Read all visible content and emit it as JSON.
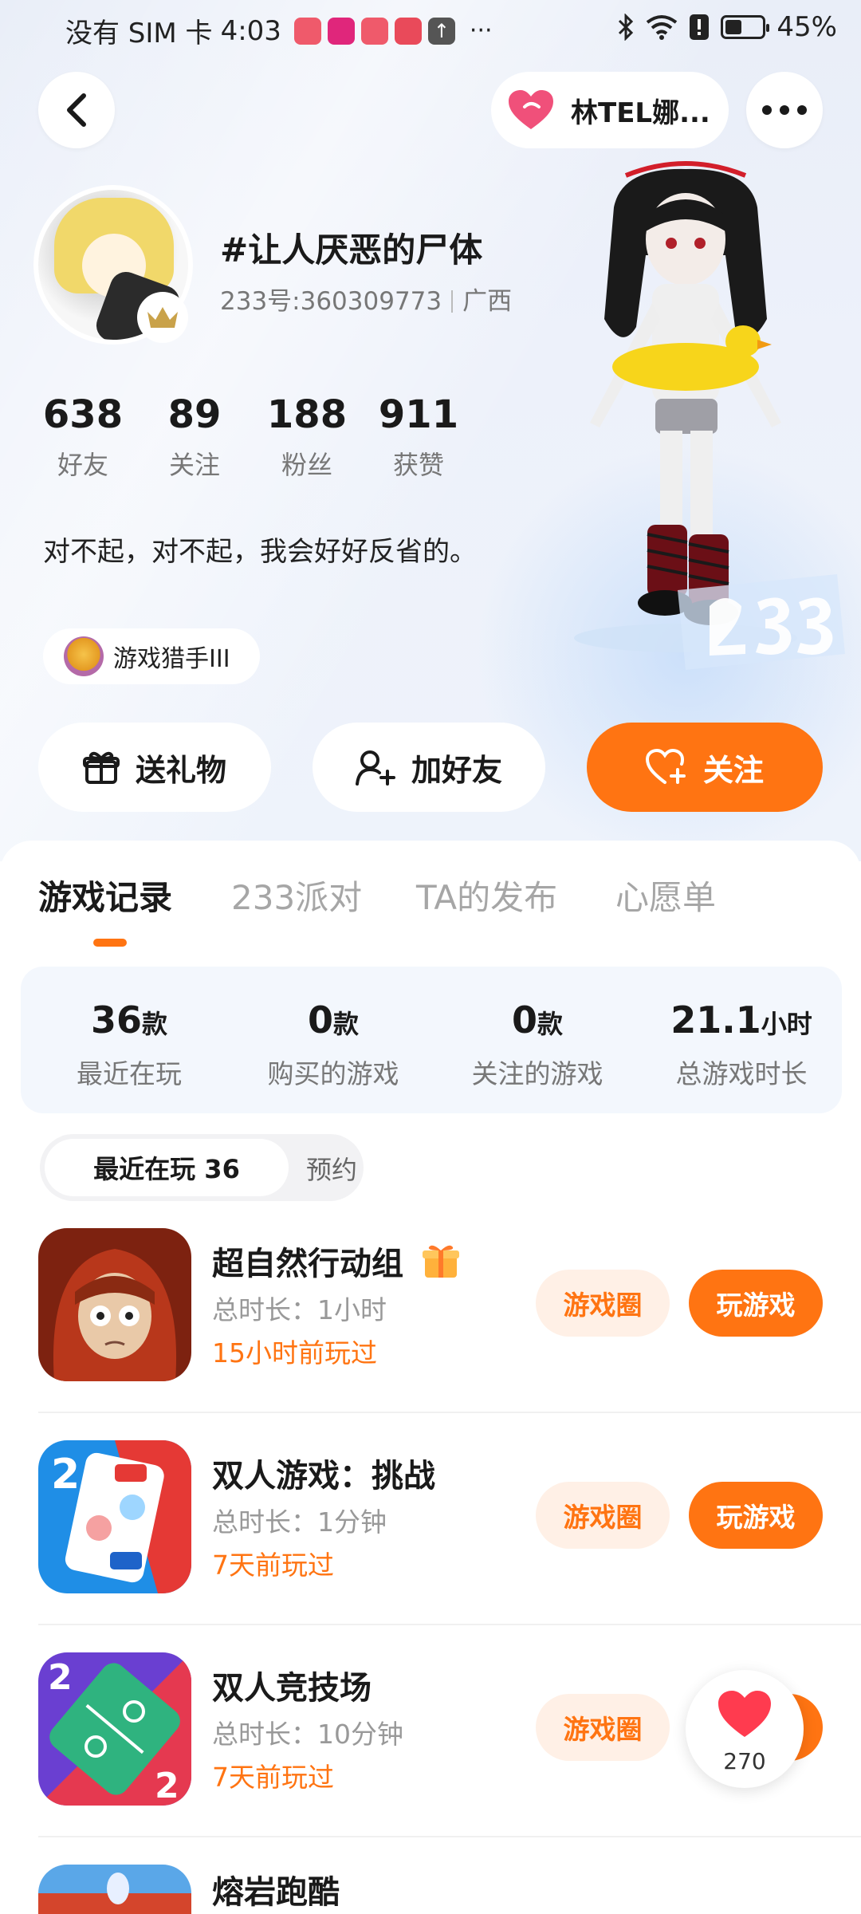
{
  "status_bar": {
    "carrier": "没有 SIM 卡",
    "time": "4:03",
    "more": "···",
    "battery_percent": "45%",
    "battery_level": 0.45
  },
  "header": {
    "friend_pill_name": "林TEL娜...",
    "accent_color": "#ff7412"
  },
  "profile": {
    "username": "#让人厌恶的尸体",
    "id_text": "233号:360309773",
    "region": "广西",
    "stats": [
      {
        "value": "638",
        "label": "好友"
      },
      {
        "value": "89",
        "label": "关注"
      },
      {
        "value": "188",
        "label": "粉丝"
      },
      {
        "value": "911",
        "label": "获赞"
      }
    ],
    "bio": "对不起，对不起，我会好好反省的。",
    "medal": "游戏猎手III"
  },
  "actions": {
    "gift": "送礼物",
    "add_friend": "加好友",
    "follow": "关注"
  },
  "tabs": [
    {
      "label": "游戏记录",
      "active": true
    },
    {
      "label": "233派对",
      "active": false
    },
    {
      "label": "TA的发布",
      "active": false
    },
    {
      "label": "心愿单",
      "active": false
    }
  ],
  "summary": [
    {
      "value": "36",
      "unit": "款",
      "label": "最近在玩"
    },
    {
      "value": "0",
      "unit": "款",
      "label": "购买的游戏"
    },
    {
      "value": "0",
      "unit": "款",
      "label": "关注的游戏"
    },
    {
      "value": "21.1",
      "unit": "小时",
      "label": "总游戏时长"
    }
  ],
  "segment": {
    "recent": "最近在玩 36",
    "reserve": "预约"
  },
  "games": [
    {
      "name": "超自然行动组",
      "duration": "总时长：1小时",
      "last_played": "15小时前玩过",
      "circle": "游戏圈",
      "play": "玩游戏"
    },
    {
      "name": "双人游戏：挑战",
      "duration": "总时长：1分钟",
      "last_played": "7天前玩过",
      "circle": "游戏圈",
      "play": "玩游戏"
    },
    {
      "name": "双人竞技场",
      "duration": "总时长：10分钟",
      "last_played": "7天前玩过",
      "circle": "游戏圈",
      "play": "玩游戏"
    },
    {
      "name": "熔岩跑酷"
    }
  ],
  "like_count": "270"
}
